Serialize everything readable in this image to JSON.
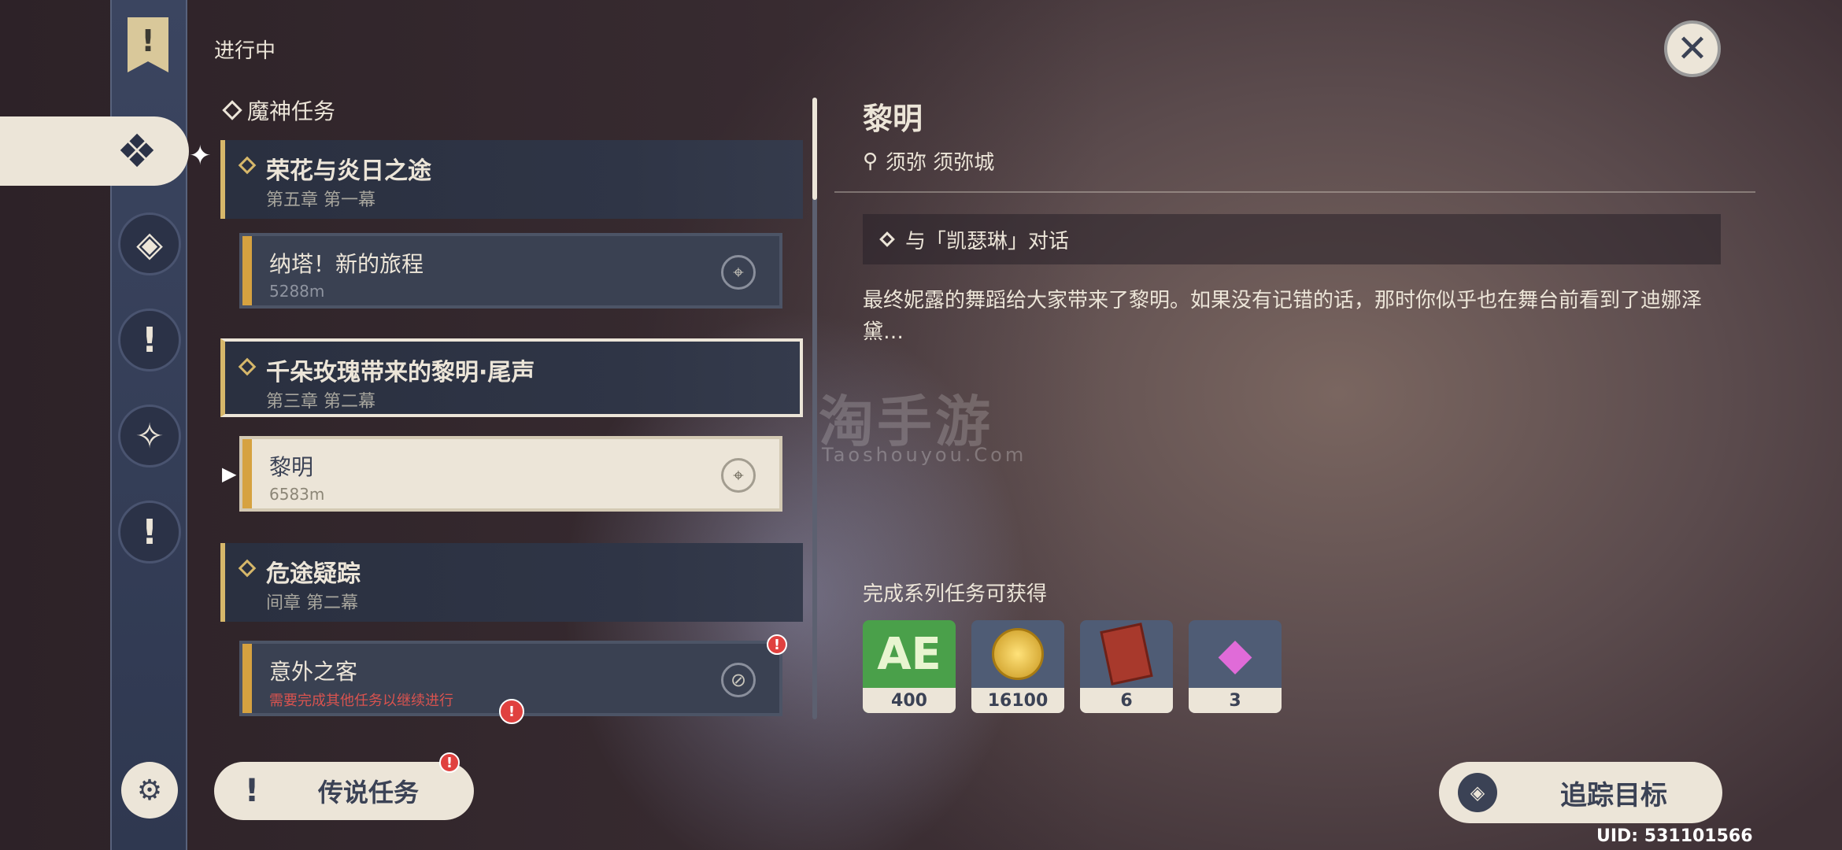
{
  "status_label": "进行中",
  "category": "魔神任务",
  "quests": [
    {
      "title": "荣花与炎日之途",
      "chapter": "第五章 第一幕",
      "sub": {
        "title": "纳塔！新的旅程",
        "distance": "5288m"
      }
    },
    {
      "title": "千朵玫瑰带来的黎明·尾声",
      "chapter": "第三章 第二幕",
      "sub": {
        "title": "黎明",
        "distance": "6583m"
      }
    },
    {
      "title": "危途疑踪",
      "chapter": "间章 第二幕",
      "sub": {
        "title": "意外之客",
        "note": "需要完成其他任务以继续进行"
      }
    }
  ],
  "legend_button": "传说任务",
  "detail": {
    "title": "黎明",
    "location": "须弥 须弥城",
    "objective": "与「凯瑟琳」对话",
    "description": "最终妮露的舞蹈给大家带来了黎明。如果没有记错的话，那时你似乎也在舞台前看到了迪娜泽黛…",
    "reward_label": "完成系列任务可获得",
    "rewards": [
      {
        "icon": "adventure-exp-icon",
        "count": "400",
        "color": "#4aa04a"
      },
      {
        "icon": "mora-icon",
        "count": "16100",
        "color": "#4f5c75"
      },
      {
        "icon": "book-icon",
        "count": "6",
        "color": "#4f5c75"
      },
      {
        "icon": "crystal-icon",
        "count": "3",
        "color": "#4f5c75"
      }
    ]
  },
  "track_button": "追踪目标",
  "uid": "UID: 531101566",
  "watermark": {
    "main": "淘手游",
    "sub": "Taoshouyou.Com"
  },
  "icons": {
    "bookmark": "!",
    "sidebar_active": "❖",
    "side1": "◈",
    "side2": "!",
    "side3": "✧",
    "side4": "!",
    "close": "✕",
    "pin": "⌖",
    "blocked": "⊘",
    "legend": "!",
    "settings": "⚙",
    "track": "◈",
    "location_pin": "⚲",
    "badge": "!"
  }
}
